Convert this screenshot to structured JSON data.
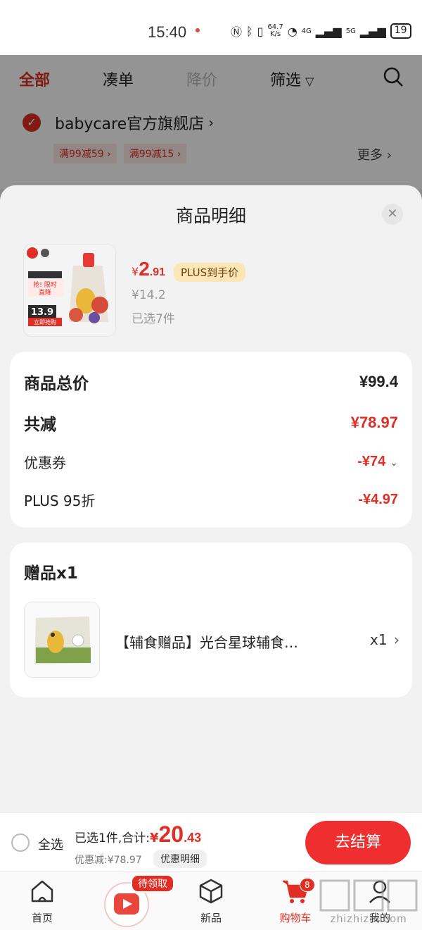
{
  "status_bar": {
    "time": "15:40",
    "net_speed_value": "64.7",
    "net_speed_unit": "K/s",
    "battery": "19",
    "net_4g": "4G",
    "net_5g": "5G"
  },
  "tabs": [
    "全部",
    "凑单",
    "降价",
    "筛选"
  ],
  "store": {
    "name": "babycare官方旗舰店",
    "coupons": [
      "满99减59",
      "满99减15"
    ],
    "more_label": "更多"
  },
  "sheet": {
    "title": "商品明细",
    "product": {
      "price_symbol": "¥",
      "price_int": "2",
      "price_dec": ".91",
      "plus_tag": "PLUS到手价",
      "original_price": "¥14.2",
      "selected_count": "已选7件",
      "thumb_texts": [
        "抢! 限时",
        "直降",
        "13.9",
        "立即抢购"
      ]
    },
    "summary": {
      "total_label": "商品总价",
      "total_value": "¥99.4",
      "reduce_label": "共减",
      "reduce_value": "¥78.97",
      "coupon_label": "优惠券",
      "coupon_value": "-¥74",
      "plus_label": "PLUS 95折",
      "plus_value": "-¥4.97"
    },
    "gift": {
      "title": "赠品x1",
      "name": "【辅食赠品】光合星球辅食…",
      "qty": "x1"
    }
  },
  "checkout": {
    "select_all": "全选",
    "total_prefix": "已选1件,合计:",
    "total_symbol": "¥",
    "total_int": "20",
    "total_dec": ".43",
    "discount": "优惠减:¥78.97",
    "detail_button": "优惠明细",
    "pay_button": "去结算"
  },
  "nav": {
    "home": "首页",
    "claim_badge": "待领取",
    "new": "新品",
    "cart": "购物车",
    "cart_badge": "8",
    "mine": "我的"
  },
  "watermark": "zhizhizhi.com",
  "colors": {
    "accent": "#e02e24",
    "plus_bg": "#fce6b6",
    "sheet_bg": "#f2f2f2"
  }
}
